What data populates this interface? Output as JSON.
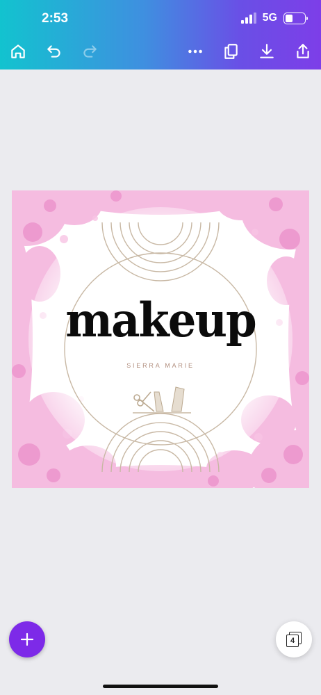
{
  "status_bar": {
    "time": "2:53",
    "network": "5G",
    "battery_level": 0.4
  },
  "toolbar": {
    "icons": [
      "home-icon",
      "undo-icon",
      "redo-icon",
      "more-icon",
      "duplicate-icon",
      "download-icon",
      "share-icon"
    ]
  },
  "design": {
    "title": "makeup",
    "subtitle": "SIERRA MARIE",
    "accent_color": "#c8b8a4",
    "splash_color": "#f2a6d6"
  },
  "pages_button": {
    "count": "4"
  },
  "colors": {
    "gradient_start": "#12c3cf",
    "gradient_end": "#7d3ee8",
    "fab": "#7d2ae8",
    "background": "#ebebef"
  }
}
